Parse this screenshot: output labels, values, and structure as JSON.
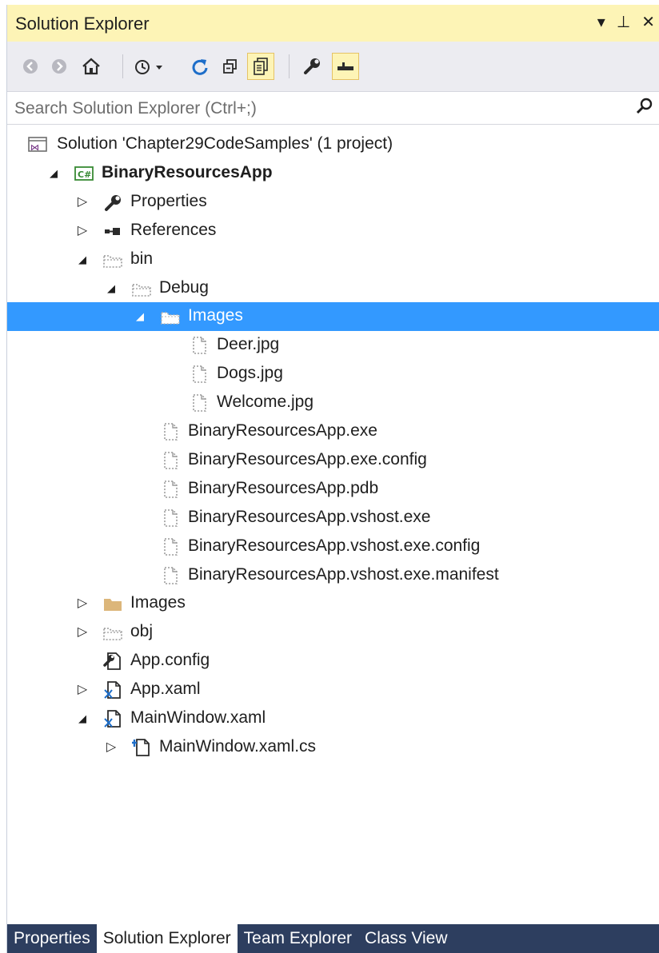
{
  "window": {
    "title": "Solution Explorer",
    "title_buttons": [
      {
        "name": "dropdown-icon",
        "glyph": "▾"
      },
      {
        "name": "pin-icon",
        "glyph": "⊥"
      },
      {
        "name": "close-icon",
        "glyph": "✕"
      }
    ]
  },
  "toolbar": {
    "buttons": [
      {
        "name": "back-icon",
        "glyph": "◀"
      },
      {
        "name": "forward-icon",
        "glyph": "▶"
      },
      {
        "name": "home-icon",
        "glyph": "⌂"
      },
      {
        "name": "pending-changes-icon",
        "glyph": "◷"
      },
      {
        "name": "refresh-icon",
        "glyph": "↻"
      },
      {
        "name": "collapse-all-icon",
        "glyph": "⊟"
      },
      {
        "name": "show-all-files-icon",
        "glyph": "▤"
      },
      {
        "name": "properties-wrench-icon",
        "glyph": "🔧"
      },
      {
        "name": "preview-selected-icon",
        "glyph": "▬"
      }
    ]
  },
  "search": {
    "placeholder": "Search Solution Explorer (Ctrl+;)",
    "icon": "search-icon"
  },
  "tree": [
    {
      "label": "Solution 'Chapter29CodeSamples' (1 project)",
      "icon": "solution-icon",
      "expander": "none",
      "level": 0,
      "bold": false,
      "selected": false
    },
    {
      "label": "BinaryResourcesApp",
      "icon": "csharp-project-icon",
      "expander": "expanded",
      "level": 0,
      "bold": true,
      "selected": false
    },
    {
      "label": "Properties",
      "icon": "wrench-icon",
      "expander": "collapsed",
      "level": 1,
      "bold": false,
      "selected": false
    },
    {
      "label": "References",
      "icon": "references-icon",
      "expander": "collapsed",
      "level": 1,
      "bold": false,
      "selected": false
    },
    {
      "label": "bin",
      "icon": "hidden-folder-icon",
      "expander": "expanded",
      "level": 1,
      "bold": false,
      "selected": false
    },
    {
      "label": "Debug",
      "icon": "hidden-folder-icon",
      "expander": "expanded",
      "level": 2,
      "bold": false,
      "selected": false
    },
    {
      "label": "Images",
      "icon": "hidden-folder-icon",
      "expander": "expanded",
      "level": 3,
      "bold": false,
      "selected": true
    },
    {
      "label": "Deer.jpg",
      "icon": "hidden-file-icon",
      "expander": "none",
      "level": 4,
      "bold": false,
      "selected": false
    },
    {
      "label": "Dogs.jpg",
      "icon": "hidden-file-icon",
      "expander": "none",
      "level": 4,
      "bold": false,
      "selected": false
    },
    {
      "label": "Welcome.jpg",
      "icon": "hidden-file-icon",
      "expander": "none",
      "level": 4,
      "bold": false,
      "selected": false
    },
    {
      "label": "BinaryResourcesApp.exe",
      "icon": "hidden-file-icon",
      "expander": "none",
      "level": 3,
      "bold": false,
      "selected": false
    },
    {
      "label": "BinaryResourcesApp.exe.config",
      "icon": "hidden-file-icon",
      "expander": "none",
      "level": 3,
      "bold": false,
      "selected": false
    },
    {
      "label": "BinaryResourcesApp.pdb",
      "icon": "hidden-file-icon",
      "expander": "none",
      "level": 3,
      "bold": false,
      "selected": false
    },
    {
      "label": "BinaryResourcesApp.vshost.exe",
      "icon": "hidden-file-icon",
      "expander": "none",
      "level": 3,
      "bold": false,
      "selected": false
    },
    {
      "label": "BinaryResourcesApp.vshost.exe.config",
      "icon": "hidden-file-icon",
      "expander": "none",
      "level": 3,
      "bold": false,
      "selected": false
    },
    {
      "label": "BinaryResourcesApp.vshost.exe.manifest",
      "icon": "hidden-file-icon",
      "expander": "none",
      "level": 3,
      "bold": false,
      "selected": false
    },
    {
      "label": "Images",
      "icon": "folder-icon",
      "expander": "collapsed",
      "level": 1,
      "bold": false,
      "selected": false
    },
    {
      "label": "obj",
      "icon": "hidden-folder-icon",
      "expander": "collapsed",
      "level": 1,
      "bold": false,
      "selected": false
    },
    {
      "label": "App.config",
      "icon": "config-file-icon",
      "expander": "none",
      "level": 1,
      "bold": false,
      "selected": false
    },
    {
      "label": "App.xaml",
      "icon": "xaml-file-icon",
      "expander": "collapsed",
      "level": 1,
      "bold": false,
      "selected": false
    },
    {
      "label": "MainWindow.xaml",
      "icon": "xaml-file-icon",
      "expander": "expanded",
      "level": 1,
      "bold": false,
      "selected": false
    },
    {
      "label": "MainWindow.xaml.cs",
      "icon": "csharp-file-icon",
      "expander": "collapsed",
      "level": 2,
      "bold": false,
      "selected": false
    }
  ],
  "tabs": [
    {
      "label": "Properties",
      "active": false
    },
    {
      "label": "Solution Explorer",
      "active": true
    },
    {
      "label": "Team Explorer",
      "active": false
    },
    {
      "label": "Class View",
      "active": false
    }
  ],
  "colors": {
    "title_bar": "#fdf4b6",
    "selection": "#3399ff",
    "tab_strip": "#2d3e5f",
    "toolbar": "#ececf1"
  }
}
